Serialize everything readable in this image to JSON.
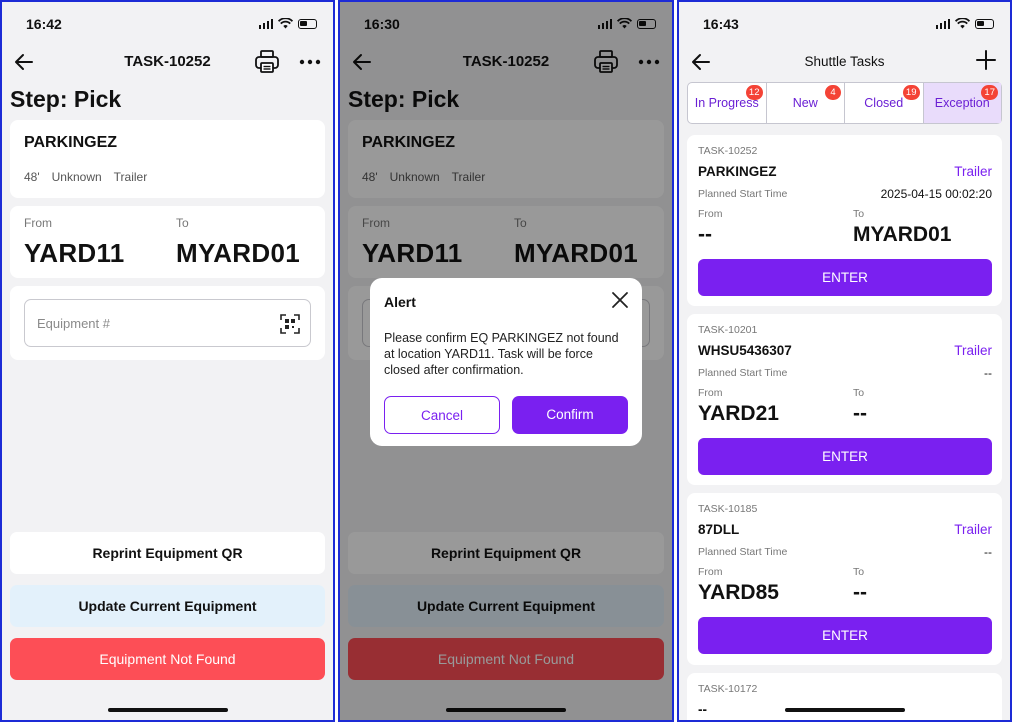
{
  "colors": {
    "accent": "#7a20f0",
    "danger": "#fd4e56",
    "badge": "#f44336",
    "frame": "#1d2bd6"
  },
  "screen1": {
    "time": "16:42",
    "nav_title": "TASK-10252",
    "step_title": "Step: Pick",
    "equipment": {
      "name": "PARKINGEZ",
      "size": "48'",
      "status": "Unknown",
      "type": "Trailer"
    },
    "from_label": "From",
    "from_value": "YARD11",
    "to_label": "To",
    "to_value": "MYARD01",
    "input_placeholder": "Equipment #",
    "btn_reprint": "Reprint Equipment QR",
    "btn_update": "Update Current Equipment",
    "btn_not_found": "Equipment Not Found"
  },
  "screen2": {
    "time": "16:30",
    "nav_title": "TASK-10252",
    "step_title": "Step: Pick",
    "equipment": {
      "name": "PARKINGEZ",
      "size": "48'",
      "status": "Unknown",
      "type": "Trailer"
    },
    "from_label": "From",
    "from_value": "YARD11",
    "to_label": "To",
    "to_value": "MYARD01",
    "btn_reprint": "Reprint Equipment QR",
    "btn_update": "Update Current Equipment",
    "btn_not_found": "Equipment Not Found",
    "dialog": {
      "title": "Alert",
      "message": "Please confirm EQ PARKINGEZ not found at location YARD11. Task will be force closed after confirmation.",
      "cancel": "Cancel",
      "confirm": "Confirm"
    }
  },
  "screen3": {
    "time": "16:43",
    "nav_title": "Shuttle Tasks",
    "tabs": [
      {
        "label": "In Progress",
        "count": "12"
      },
      {
        "label": "New",
        "count": "4"
      },
      {
        "label": "Closed",
        "count": "19"
      },
      {
        "label": "Exception",
        "count": "17"
      }
    ],
    "tasks": [
      {
        "id": "TASK-10252",
        "equipment": "PARKINGEZ",
        "type": "Trailer",
        "planned_label": "Planned Start Time",
        "planned_value": "2025-04-15 00:02:20",
        "from_label": "From",
        "from_value": "--",
        "to_label": "To",
        "to_value": "MYARD01",
        "enter": "ENTER"
      },
      {
        "id": "TASK-10201",
        "equipment": "WHSU5436307",
        "type": "Trailer",
        "planned_label": "Planned Start Time",
        "planned_value": "--",
        "from_label": "From",
        "from_value": "YARD21",
        "to_label": "To",
        "to_value": "--",
        "enter": "ENTER"
      },
      {
        "id": "TASK-10185",
        "equipment": "87DLL",
        "type": "Trailer",
        "planned_label": "Planned Start Time",
        "planned_value": "--",
        "from_label": "From",
        "from_value": "YARD85",
        "to_label": "To",
        "to_value": "--",
        "enter": "ENTER"
      },
      {
        "id": "TASK-10172",
        "equipment": "--"
      }
    ]
  }
}
